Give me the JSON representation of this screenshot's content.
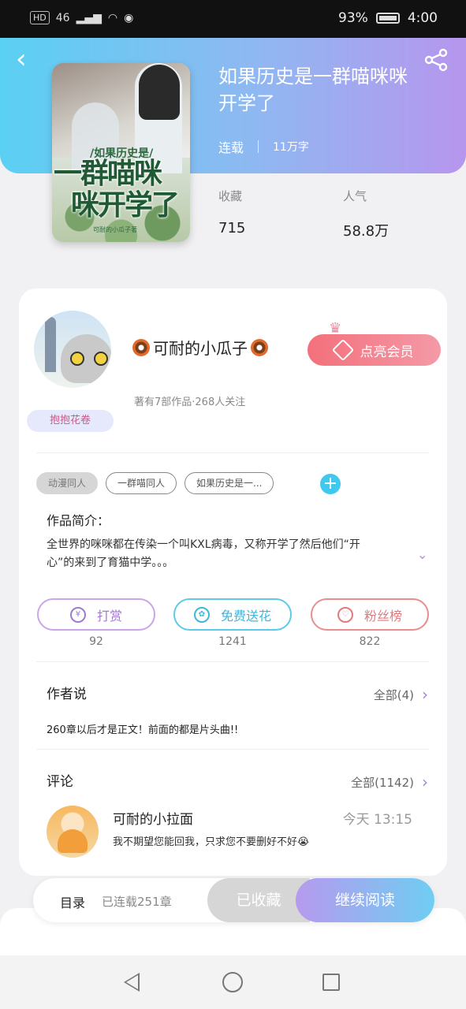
{
  "status_bar": {
    "left_badge": "HD",
    "network": "46",
    "battery_pct": "93%",
    "time": "4:00"
  },
  "header": {
    "back_glyph": "‹"
  },
  "book": {
    "title": "如果历史是一群喵咪咪开学了",
    "status": "连载",
    "word_count": "11万字",
    "cover": {
      "line1": "/如果历史是/",
      "line2": "一群喵咪",
      "line3": "咪开学了",
      "line4": "可耐的小瓜子著"
    },
    "stats": [
      {
        "label": "收藏",
        "value": "715"
      },
      {
        "label": "人气",
        "value": "58.8万"
      }
    ]
  },
  "author": {
    "name": "可耐的小瓜子",
    "subtitle": "著有7部作品·268人关注",
    "badge": "抱抱花卷",
    "vip_label": "点亮会员",
    "crown_glyph": "♛"
  },
  "tags": [
    "动漫同人",
    "一群喵同人",
    "如果历史是一..."
  ],
  "tag_add": "+",
  "intro": {
    "title": "作品简介：",
    "text": "全世界的咪咪都在传染一个叫KXL病毒，又称开学了然后他们“开心”的来到了育猫中学。。。",
    "expand_glyph": "⌄"
  },
  "actions": [
    {
      "label": "打赏",
      "icon": "¥",
      "count": "92"
    },
    {
      "label": "免费送花",
      "icon": "✿",
      "count": "1241"
    },
    {
      "label": "粉丝榜",
      "icon": "♡",
      "count": "822"
    }
  ],
  "author_says": {
    "title": "作者说",
    "more": "全部(4)",
    "text": "260章以后才是正文！前面的都是片头曲!!"
  },
  "comments": {
    "title": "评论",
    "more": "全部(1142)",
    "items": [
      {
        "name": "可耐的小拉面",
        "time": "今天 13:15",
        "text": "我不期望您能回我，只求您不要删好不好😭"
      }
    ]
  },
  "bottom_bar": {
    "toc": "目录",
    "toc_sub": "已连载251章",
    "saved": "已收藏",
    "read": "继续阅读"
  },
  "colors": {
    "accent_blue": "#41c8ee",
    "accent_purple": "#b796ee",
    "vip_pink": "#f3707b"
  }
}
